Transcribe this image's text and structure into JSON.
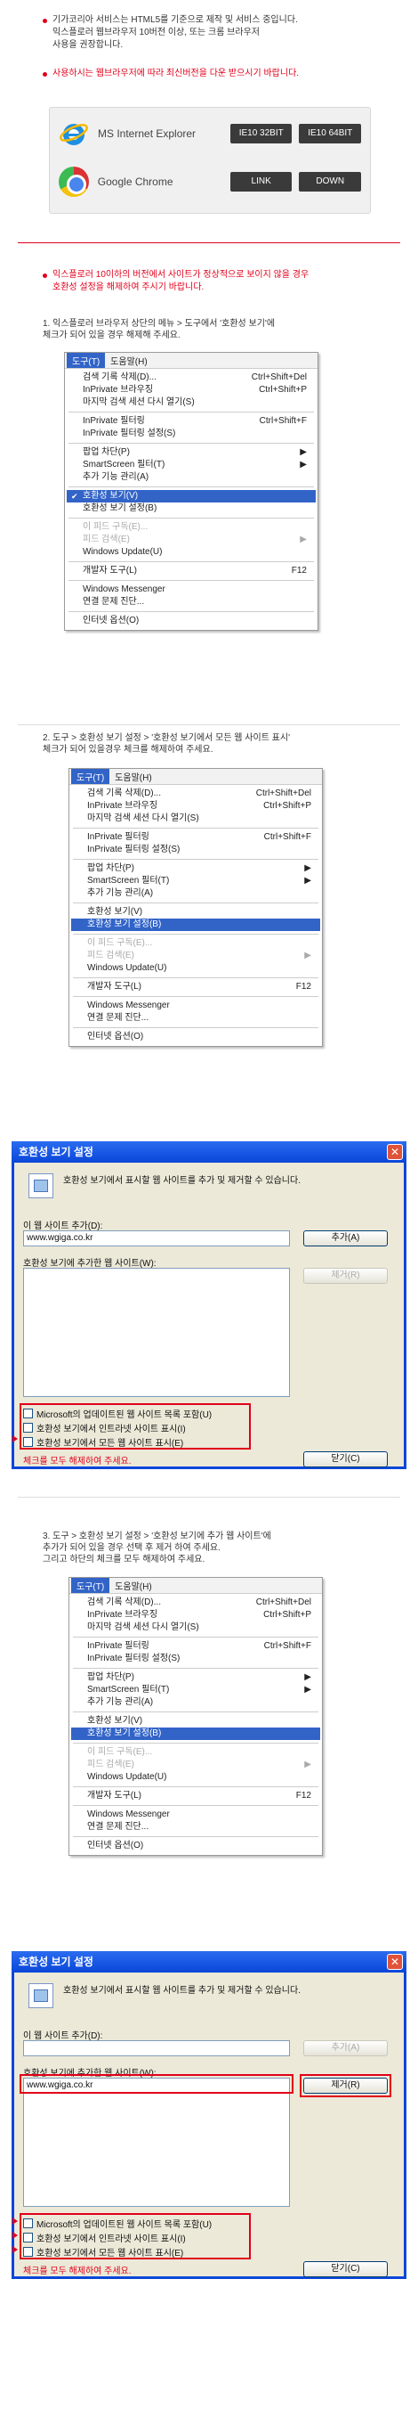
{
  "intro": {
    "line1": "기가코리아 서비스는 HTML5를 기준으로 제작 및 서비스 중입니다.",
    "line2": "익스플로러 웹브라우저 10버전 이상, 또는 크롬 브라우저",
    "line3": "사용을 권장합니다.",
    "notice": "사용하시는 웹브라우저에 따라 최신버전을 다운 받으시기 바랍니다."
  },
  "browsers": [
    {
      "name": "MS Internet Explorer",
      "icon": "ie-logo-icon",
      "buttons": [
        "IE10 32BIT",
        "IE10 64BIT"
      ]
    },
    {
      "name": "Google Chrome",
      "icon": "chrome-logo-icon",
      "buttons": [
        "LINK",
        "DOWN"
      ]
    }
  ],
  "warning": {
    "line1": "익스플로러 10이하의 버전에서 사이트가 정상적으로 보이지 않을 경우",
    "line2": "호환성 설정을 해제하여 주시기 바랍니다."
  },
  "steps": [
    {
      "line1": "1. 익스플로러 브라우저 상단의 메뉴 > 도구에서 '호환성 보기'에",
      "line2": "체크가 되어 있을 경우 해제해 주세요.",
      "line3": ""
    },
    {
      "line1": "2. 도구 > 호환성 보기 설정 > '호환성 보기에서 모든 웹 사이트 표시'",
      "line2": "체크가 되어 있을경우 체크를 해제하여 주세요.",
      "line3": ""
    },
    {
      "line1": "3. 도구 > 호환성 보기 설정 > '호환성 보기에 추가 웹 사이트'에",
      "line2": "추가가 되어 있을 경우 선택 후 제거 하여 주세요.",
      "line3": "그리고 하단의 체크를 모두 해제하여 주세요."
    }
  ],
  "menu": {
    "bar": [
      "도구(T)",
      "도움말(H)"
    ],
    "groups": [
      [
        {
          "label": "검색 기록 삭제(D)...",
          "shortcut": "Ctrl+Shift+Del"
        },
        {
          "label": "InPrivate 브라우징",
          "shortcut": "Ctrl+Shift+P"
        },
        {
          "label": "마지막 검색 세션 다시 열기(S)",
          "shortcut": ""
        }
      ],
      [
        {
          "label": "InPrivate 필터링",
          "shortcut": "Ctrl+Shift+F"
        },
        {
          "label": "InPrivate 필터링 설정(S)",
          "shortcut": ""
        }
      ],
      [
        {
          "label": "팝업 차단(P)",
          "shortcut": "▶"
        },
        {
          "label": "SmartScreen 필터(T)",
          "shortcut": "▶"
        },
        {
          "label": "추가 기능 관리(A)",
          "shortcut": ""
        }
      ],
      [
        {
          "label": "호환성 보기(V)",
          "shortcut": ""
        },
        {
          "label": "호환성 보기 설정(B)",
          "shortcut": ""
        }
      ],
      [
        {
          "label": "이 피드 구독(E)...",
          "shortcut": ""
        },
        {
          "label": "피드 검색(E)",
          "shortcut": "▶"
        },
        {
          "label": "Windows Update(U)",
          "shortcut": ""
        }
      ],
      [
        {
          "label": "개발자 도구(L)",
          "shortcut": "F12"
        }
      ],
      [
        {
          "label": "Windows Messenger",
          "shortcut": ""
        },
        {
          "label": "연결 문제 진단...",
          "shortcut": ""
        }
      ],
      [
        {
          "label": "인터넷 옵션(O)",
          "shortcut": ""
        }
      ]
    ]
  },
  "dialog": {
    "title": "호환성 보기 설정",
    "description": "호환성 보기에서 표시할 웹 사이트를 추가 및 제거할 수 있습니다.",
    "add_label": "이 웹 사이트 추가(D):",
    "add_value": "www.wgiga.co.kr",
    "add_button": "추가(A)",
    "list_label": "호환성 보기에 추가한 웹 사이트(W):",
    "list_item": "www.wgiga.co.kr",
    "remove_button": "제거(R)",
    "checks": [
      "Microsoft의 업데이트된 웹 사이트 목록 포함(U)",
      "호환성 보기에서 인트라넷 사이트 표시(I)",
      "호환성 보기에서 모든 웹 사이트 표시(E)"
    ],
    "note": "체크를 모두 해제하여 주세요.",
    "close_button": "닫기(C)"
  },
  "colors": {
    "accent": "#e0001b",
    "dialog_blue": "#0a46d9",
    "menu_highlight": "#3264c8"
  }
}
